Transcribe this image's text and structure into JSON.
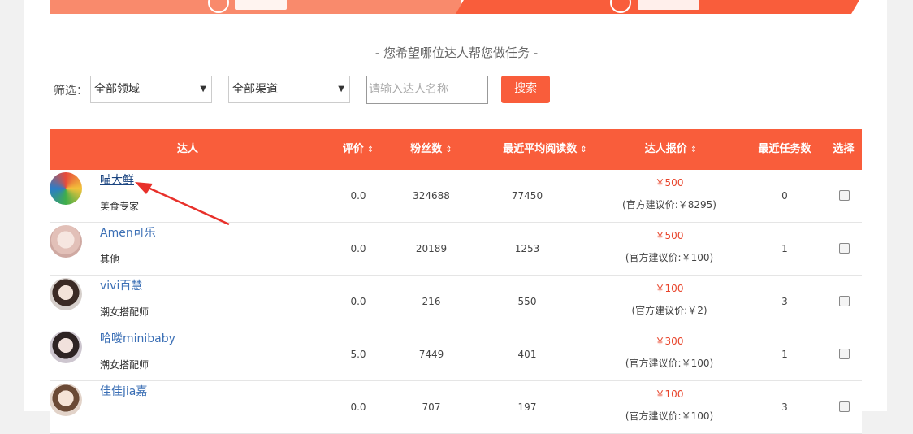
{
  "subtitle": "- 您希望哪位达人帮您做任务 -",
  "filter": {
    "label": "筛选：",
    "domain_select": "全部领域",
    "channel_select": "全部渠道",
    "search_placeholder": "请输入达人名称",
    "search_button": "搜索"
  },
  "table": {
    "headers": {
      "talent": "达人",
      "rating": "评价",
      "fans": "粉丝数",
      "avg_reads": "最近平均阅读数",
      "quote": "达人报价",
      "recent_tasks": "最近任务数",
      "select": "选择"
    },
    "sort_icon": "⇕",
    "rows": [
      {
        "name": "喵大鲜",
        "category": "美食专家",
        "rating": "0.0",
        "fans": "324688",
        "avg_reads": "77450",
        "price": "￥500",
        "official": "(官方建议价:￥8295)",
        "tasks": "0",
        "avatar_color": "#e8b23a"
      },
      {
        "name": "Amen可乐",
        "category": "其他",
        "rating": "0.0",
        "fans": "20189",
        "avg_reads": "1253",
        "price": "￥500",
        "official": "(官方建议价:￥100)",
        "tasks": "1",
        "avatar_color": "#e9d3cf"
      },
      {
        "name": "vivi百慧",
        "category": "潮女搭配师",
        "rating": "0.0",
        "fans": "216",
        "avg_reads": "550",
        "price": "￥100",
        "official": "(官方建议价:￥2)",
        "tasks": "3",
        "avatar_color": "#d8c8c0"
      },
      {
        "name": "哈喽minibaby",
        "category": "潮女搭配师",
        "rating": "5.0",
        "fans": "7449",
        "avg_reads": "401",
        "price": "￥300",
        "official": "(官方建议价:￥100)",
        "tasks": "1",
        "avatar_color": "#cfc4c8"
      },
      {
        "name": "佳佳jia嘉",
        "category": "",
        "rating": "0.0",
        "fans": "707",
        "avg_reads": "197",
        "price": "￥100",
        "official": "(官方建议价:￥100)",
        "tasks": "3",
        "avatar_color": "#e2c9b6"
      }
    ]
  },
  "colors": {
    "accent": "#f95d3b",
    "accent_light": "#f98a6c",
    "price_red": "#e8452c",
    "link_blue": "#3b6fb5"
  }
}
